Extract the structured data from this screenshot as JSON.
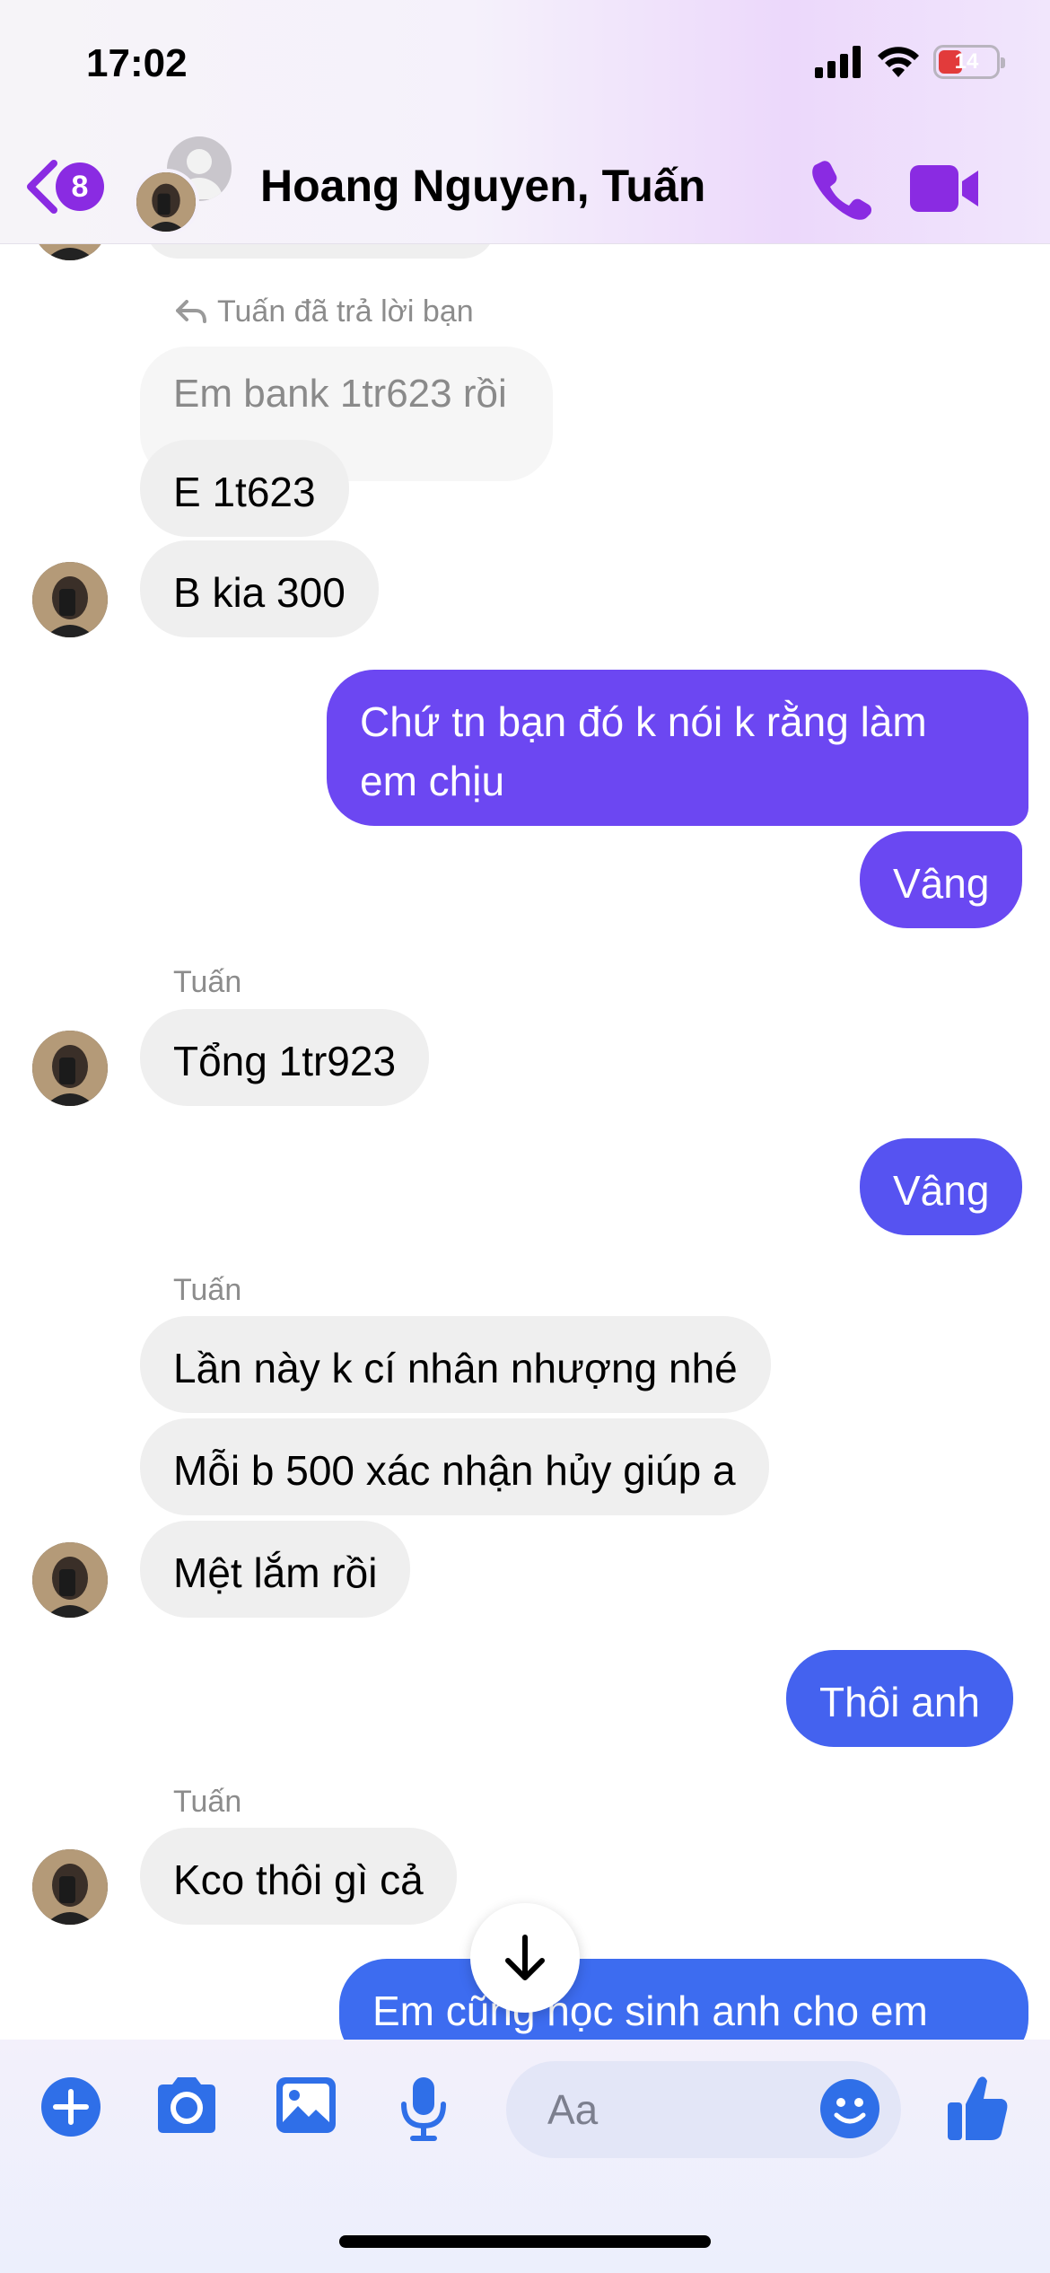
{
  "status_bar": {
    "time": "17:02",
    "battery": "14"
  },
  "header": {
    "back_badge": "8",
    "title": "Hoang Nguyen, Tuấn"
  },
  "reply_label": "Tuấn đã trả lời bạn",
  "messages": [
    {
      "id": "m1",
      "side": "in",
      "sender": "",
      "text": "Em bank 1tr623 rồi",
      "is_reply_preview": true
    },
    {
      "id": "m2",
      "side": "in",
      "sender": "",
      "text": "E 1t623"
    },
    {
      "id": "m3",
      "side": "in",
      "sender": "",
      "text": "B kia 300"
    },
    {
      "id": "m4",
      "side": "out",
      "text_lines": [
        "Chứ tn bạn đó k nói k rằng làm",
        "em chịu"
      ]
    },
    {
      "id": "m5",
      "side": "out",
      "text": "Vâng"
    },
    {
      "id": "m6",
      "side": "in",
      "sender": "Tuấn",
      "text": "Tổng 1tr923"
    },
    {
      "id": "m7",
      "side": "out",
      "text": "Vâng"
    },
    {
      "id": "m8",
      "side": "in",
      "sender": "Tuấn",
      "text": "Lần này k cí nhân nhượng nhé"
    },
    {
      "id": "m9",
      "side": "in",
      "text": "Mỗi b 500 xác nhận hủy giúp a"
    },
    {
      "id": "m10",
      "side": "in",
      "text": "Mệt lắm rồi"
    },
    {
      "id": "m11",
      "side": "out",
      "text": "Thôi anh"
    },
    {
      "id": "m12",
      "side": "in",
      "sender": "Tuấn",
      "text": "Kco thôi gì cả"
    },
    {
      "id": "m13",
      "side": "out",
      "text": "Em cũng học sinh anh cho em"
    }
  ],
  "composer": {
    "placeholder": "Aa",
    "icons": [
      "plus-icon",
      "camera-icon",
      "image-icon",
      "microphone-icon",
      "emoji-icon",
      "thumbs-up-icon"
    ]
  },
  "colors": {
    "accent": "#8a2be2",
    "out_bubble_top": "#6f45f0",
    "out_bubble_bottom": "#3d6bf0",
    "in_bubble": "#efefef",
    "composer_icon": "#2f6fe8"
  }
}
